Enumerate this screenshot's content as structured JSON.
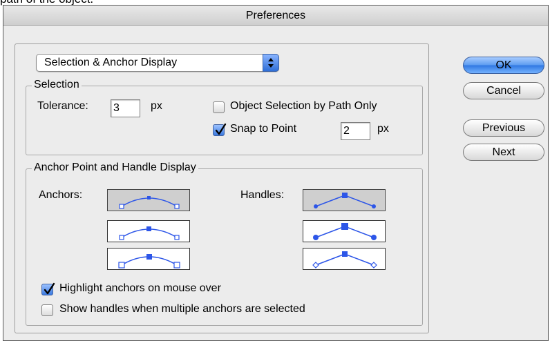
{
  "above_text": "path of the object.",
  "window": {
    "title": "Preferences"
  },
  "popup": {
    "selected": "Selection & Anchor Display"
  },
  "selection": {
    "legend": "Selection",
    "tolerance_label": "Tolerance:",
    "tolerance_value": "3",
    "tolerance_unit": "px",
    "object_selection_label": "Object Selection by Path Only",
    "object_selection_checked": false,
    "snap_label": "Snap to Point",
    "snap_checked": true,
    "snap_value": "2",
    "snap_unit": "px"
  },
  "anchor_display": {
    "legend": "Anchor Point and Handle Display",
    "anchors_label": "Anchors:",
    "handles_label": "Handles:",
    "anchors_selected_option": 1,
    "handles_selected_option": 1,
    "highlight_label": "Highlight anchors on mouse over",
    "highlight_checked": true,
    "show_handles_label": "Show handles when multiple anchors are selected",
    "show_handles_checked": false
  },
  "buttons": {
    "ok": "OK",
    "cancel": "Cancel",
    "previous": "Previous",
    "next": "Next"
  },
  "colors": {
    "accent": "#2f77e2",
    "path_blue": "#2d56e8"
  }
}
